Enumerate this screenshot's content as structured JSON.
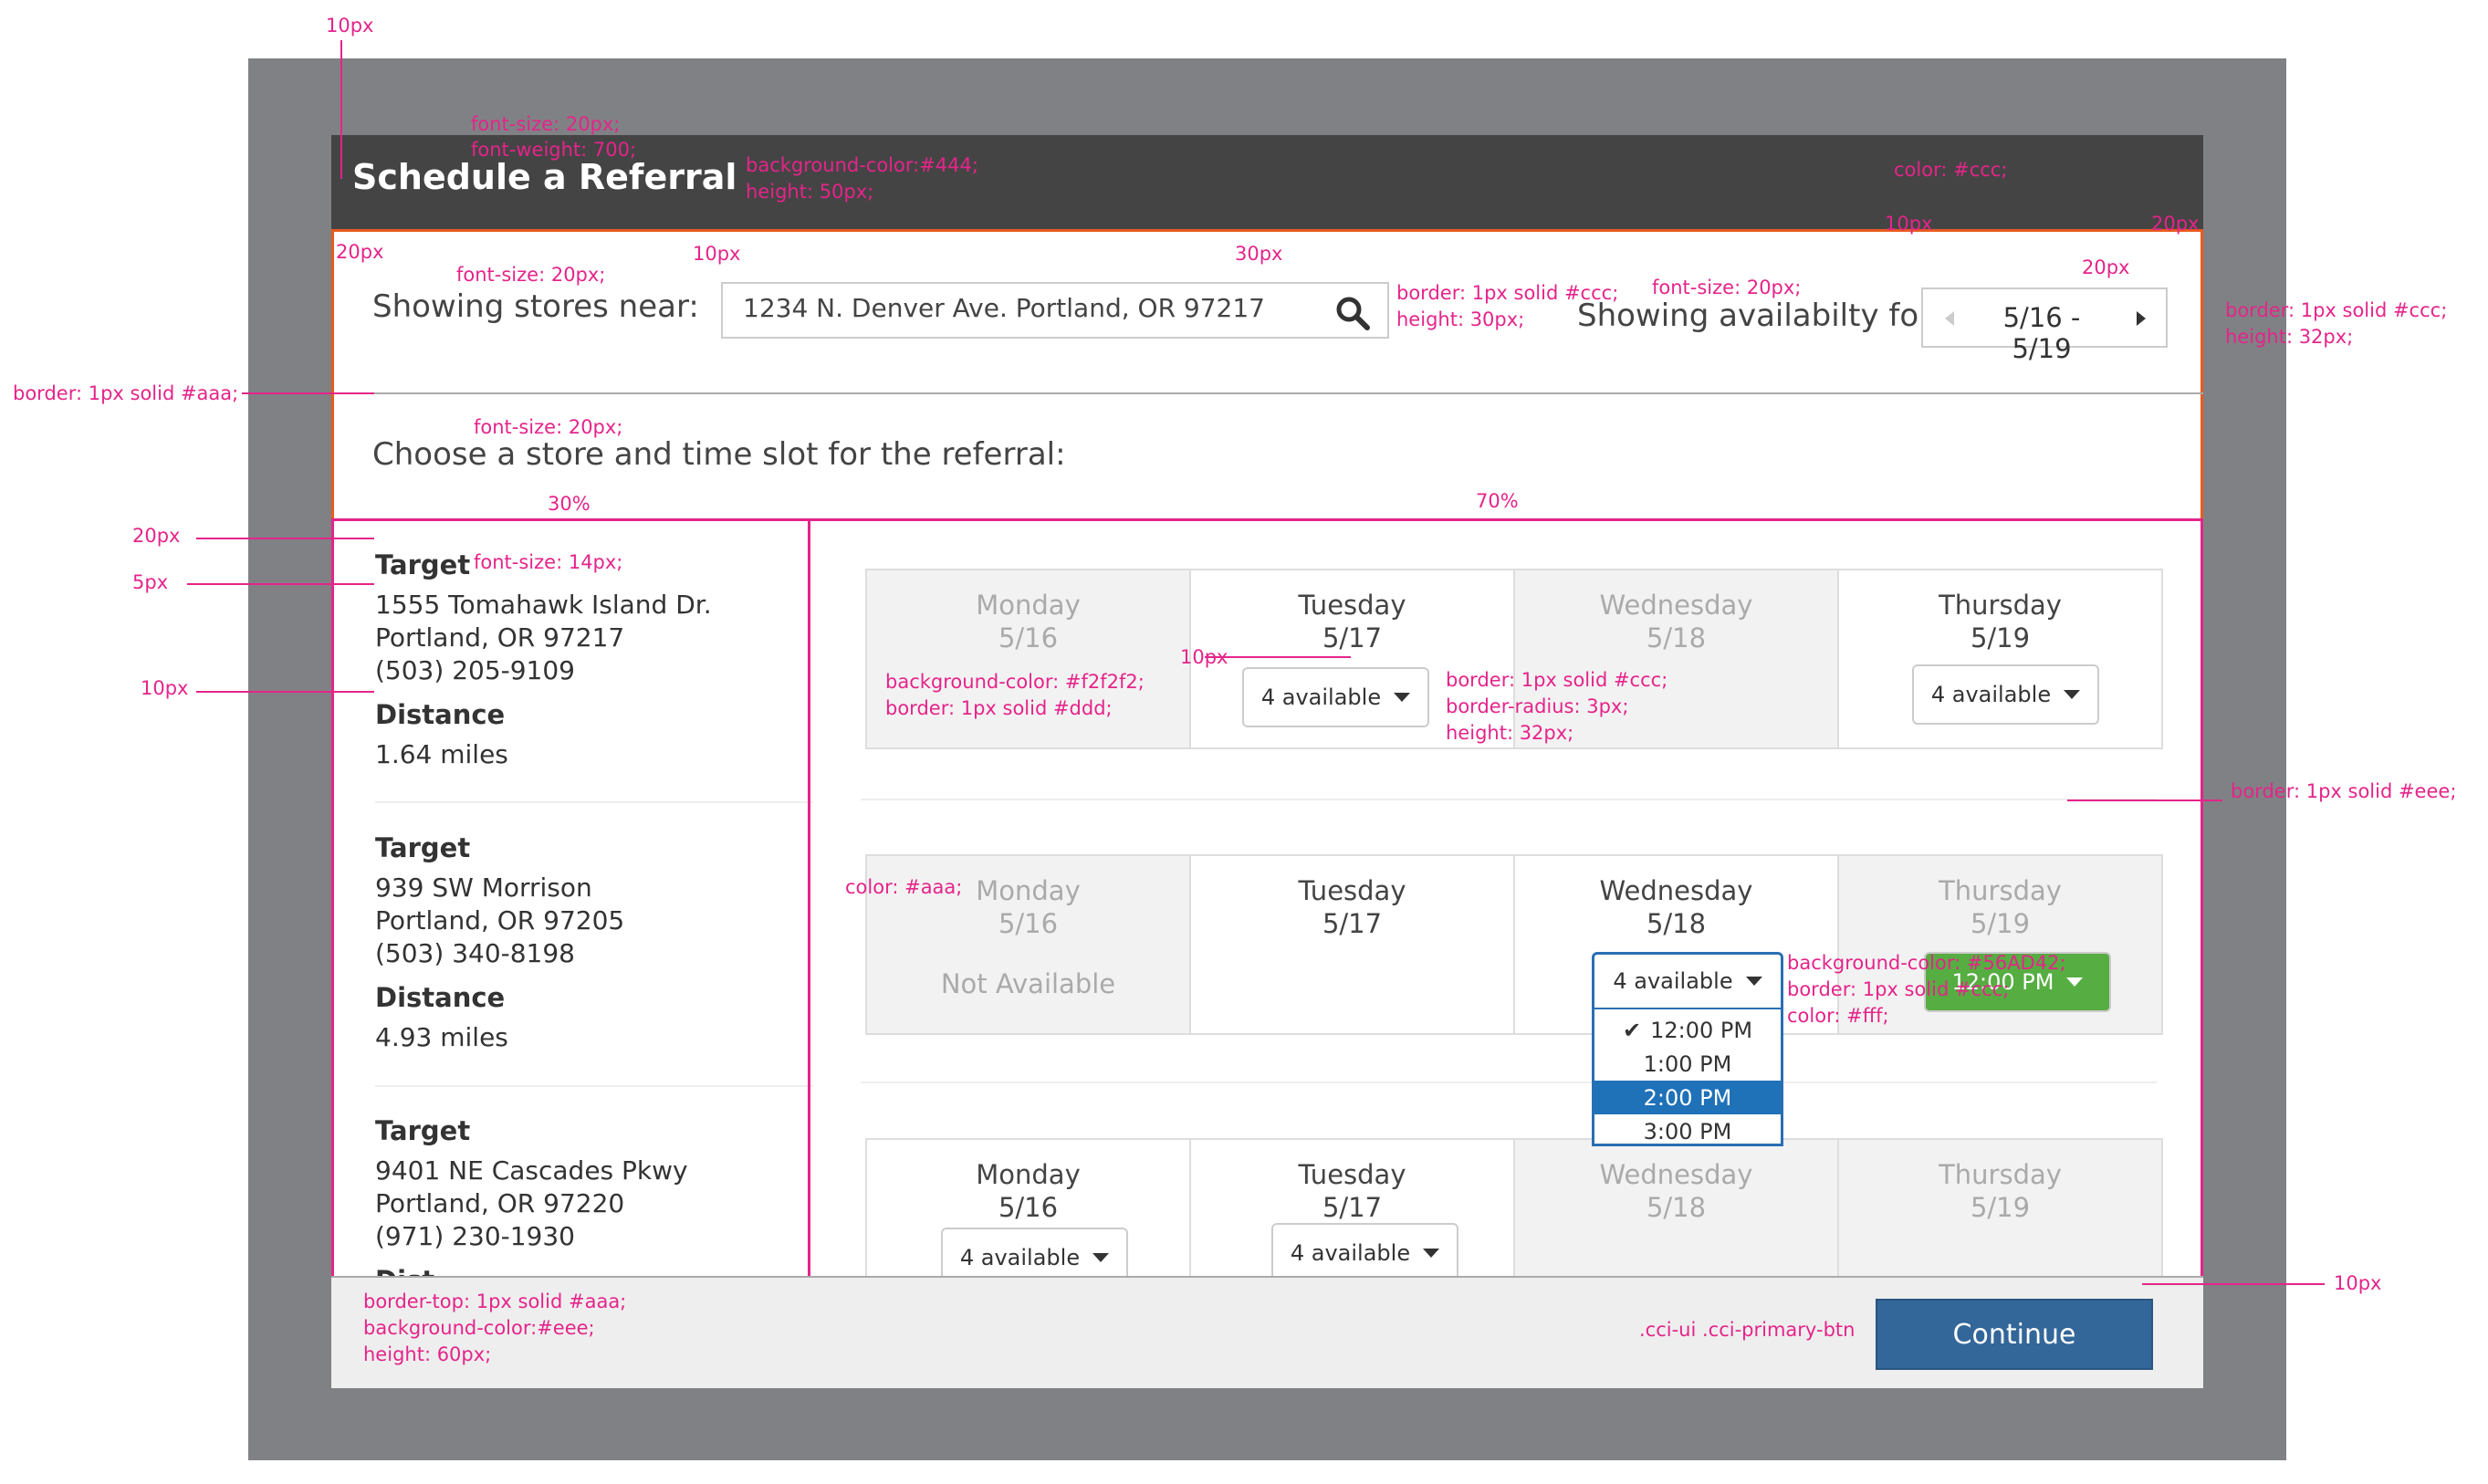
{
  "title": "Schedule a Referral",
  "search": {
    "label": "Showing stores near:",
    "value": "1234 N. Denver Ave. Portland, OR 97217"
  },
  "availability": {
    "label": "Showing availabilty for:",
    "range": "5/16 - 5/19"
  },
  "prompt": "Choose a store and time slot for the referral:",
  "distance_label": "Distance",
  "stores": [
    {
      "name": "Target",
      "street": "1555 Tomahawk Island Dr.",
      "city": "Portland, OR 97217",
      "phone": "(503) 205-9109",
      "distance": "1.64 miles"
    },
    {
      "name": "Target",
      "street": "939 SW Morrison",
      "city": "Portland, OR 97205",
      "phone": "(503) 340-8198",
      "distance": "4.93 miles"
    },
    {
      "name": "Target",
      "street": "9401 NE Cascades Pkwy",
      "city": "Portland, OR 97220",
      "phone": "(971) 230-1930",
      "distance": "Dist"
    }
  ],
  "days": [
    {
      "name": "Monday",
      "date": "5/16"
    },
    {
      "name": "Tuesday",
      "date": "5/17"
    },
    {
      "name": "Wednesday",
      "date": "5/18"
    },
    {
      "name": "Thursday",
      "date": "5/19"
    }
  ],
  "slot_labels": {
    "four": "4 available",
    "not_available": "Not Available",
    "selected_time": "12:00 PM"
  },
  "time_menu": [
    {
      "time": "12:00 PM",
      "checked": true
    },
    {
      "time": "1:00 PM"
    },
    {
      "time": "2:00 PM",
      "highlighted": true
    },
    {
      "time": "3:00 PM"
    }
  ],
  "footer": {
    "primary_class": ".cci-ui .cci-primary-btn",
    "button": "Continue"
  },
  "annotations": {
    "a1": "10px",
    "a2": "font-size: 20px;",
    "a3": "font-weight: 700;",
    "a4": "background-color:#444;",
    "a5": "height: 50px;",
    "a6": "color: #ccc;",
    "a7": "10px",
    "a8": "20px",
    "a9": "20px",
    "a10": "font-size: 20px;",
    "a11": "10px",
    "a12": "30px",
    "a13": "border: 1px solid #ccc;",
    "a14": "height: 30px;",
    "a15": "font-size: 20px;",
    "a16": "20px",
    "a17": "border: 1px solid #ccc;",
    "a18": "height: 32px;",
    "a19": "border: 1px solid #aaa;",
    "a20": "font-size: 20px;",
    "a21": "30%",
    "a22": "70%",
    "a23": "20px",
    "a24": "font-size: 14px;",
    "a25": "5px",
    "a26": "10px",
    "a27": "10px",
    "a28": "background-color: #f2f2f2;",
    "a29": "border: 1px solid #ddd;",
    "a30": "border: 1px solid #ccc;",
    "a31": "border-radius: 3px;",
    "a32": "height: 32px;",
    "a33": "border: 1px solid #eee;",
    "a34": "color: #aaa;",
    "a35": "background-color: #56AD42;",
    "a36": "border: 1px solid #ccc;",
    "a37": "color: #fff;",
    "a38": "border-top: 1px solid #aaa;",
    "a39": "background-color:#eee;",
    "a40": "height: 60px;",
    "a41": "10px"
  }
}
